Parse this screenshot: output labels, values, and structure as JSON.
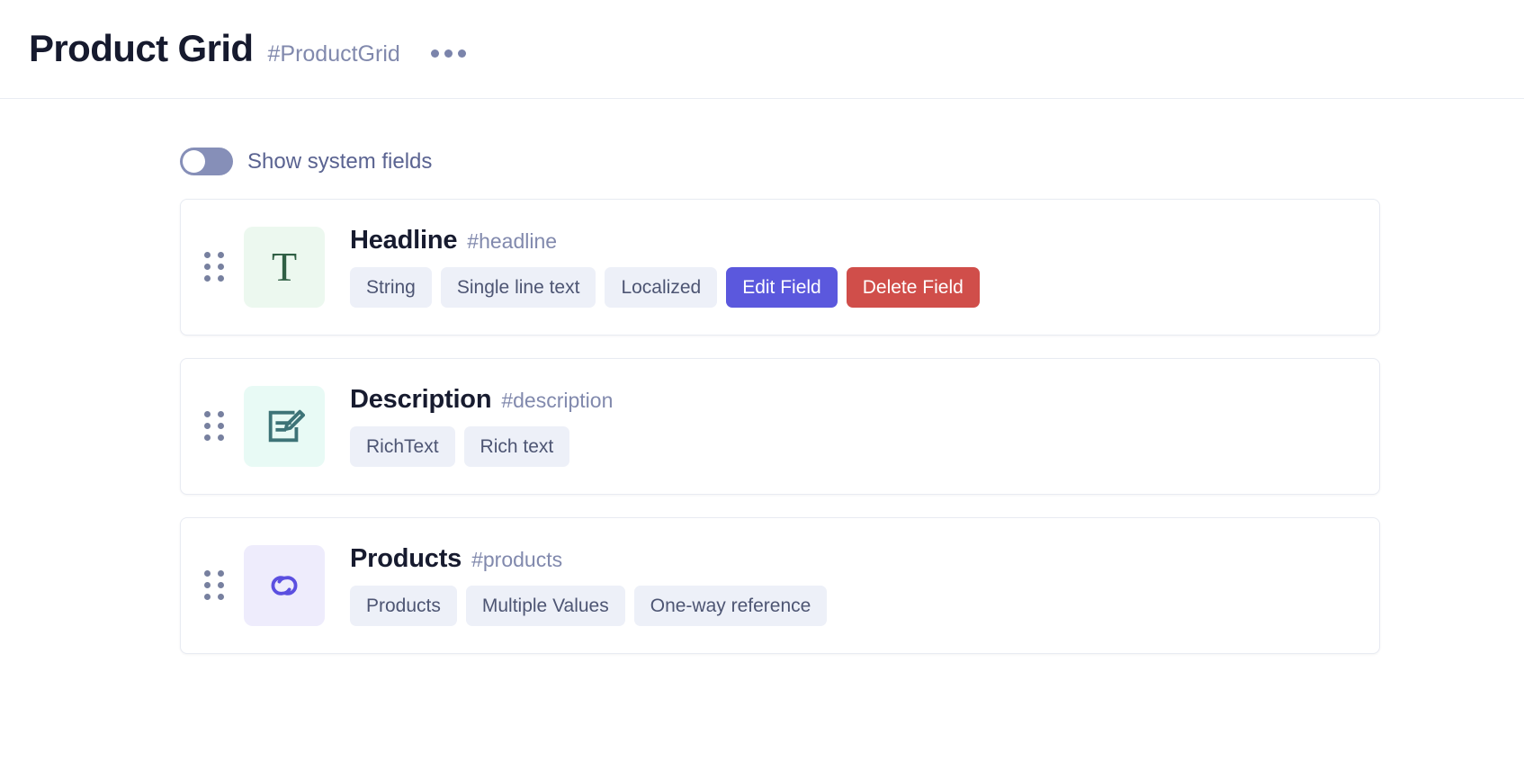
{
  "header": {
    "title": "Product Grid",
    "slug": "#ProductGrid",
    "more_menu_name": "more-options"
  },
  "toolbar": {
    "show_system_fields_label": "Show system fields",
    "show_system_fields_on": false
  },
  "colors": {
    "primary": "#5b58dd",
    "danger": "#d04e4a",
    "chip_bg": "#edf0f8",
    "chip_text": "#4d5573",
    "muted_text": "#8189ad",
    "toggle_off_track": "#868fb8"
  },
  "fields": [
    {
      "name": "Headline",
      "slug": "#headline",
      "icon": "text-type-icon",
      "icon_glyph": "T",
      "icon_theme": "green",
      "chips": [
        "String",
        "Single line text",
        "Localized"
      ],
      "actions": [
        {
          "label": "Edit Field",
          "style": "primary",
          "name": "edit-field-button"
        },
        {
          "label": "Delete Field",
          "style": "danger",
          "name": "delete-field-button"
        }
      ]
    },
    {
      "name": "Description",
      "slug": "#description",
      "icon": "rich-text-icon",
      "icon_glyph": "",
      "icon_theme": "mint",
      "chips": [
        "RichText",
        "Rich text"
      ],
      "actions": []
    },
    {
      "name": "Products",
      "slug": "#products",
      "icon": "link-reference-icon",
      "icon_glyph": "",
      "icon_theme": "lav",
      "chips": [
        "Products",
        "Multiple Values",
        "One-way reference"
      ],
      "actions": []
    }
  ]
}
